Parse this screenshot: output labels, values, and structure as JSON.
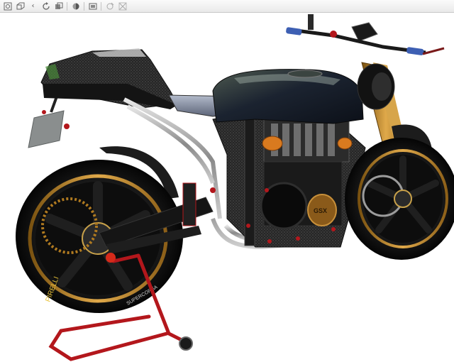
{
  "toolbar": {
    "buttons": [
      {
        "id": "zoom",
        "icon": "zoom-window-icon"
      },
      {
        "id": "view-cube",
        "icon": "view-orient-icon"
      },
      {
        "id": "rotate",
        "icon": "rotate-icon"
      },
      {
        "id": "pan",
        "icon": "pan-icon"
      },
      {
        "id": "section",
        "icon": "section-view-icon"
      },
      {
        "id": "display",
        "icon": "display-style-icon"
      },
      {
        "id": "scene",
        "icon": "scene-icon"
      },
      {
        "id": "markup",
        "icon": "markup-icon"
      }
    ]
  },
  "viewport": {
    "model": "motorcycle-render",
    "background": "#ffffff",
    "tire_text_rear": "PIRELLI",
    "tire_text_rear_b": "SUPERCORSA",
    "engine_badge": "GSX",
    "colors": {
      "tire": "#161616",
      "rim_gold": "#b8862b",
      "frame_carbon": "#2a2a2a",
      "tank": "#1d2a2a",
      "exhaust": "#9a9a9a",
      "stand_red": "#b3171c",
      "fork_gold": "#c08a2a",
      "handlebar_blue": "#3d5fb3"
    }
  }
}
